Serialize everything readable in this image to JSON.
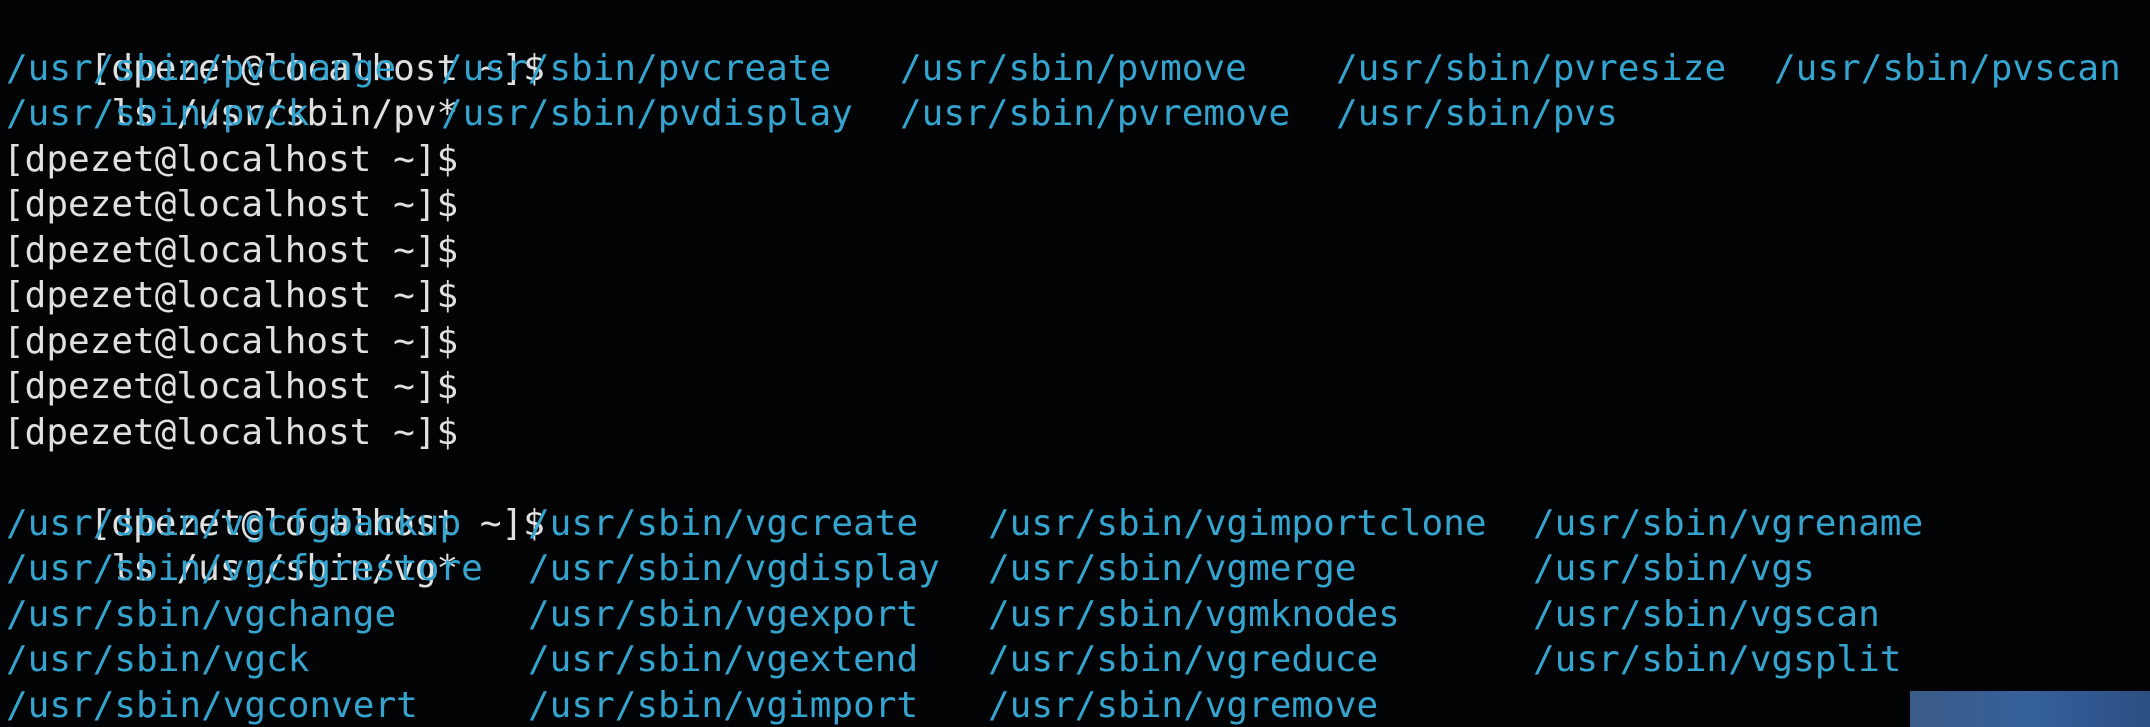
{
  "colors": {
    "background": "#020304",
    "prompt_text": "#e0e0e0",
    "executable_text": "#35a4ce"
  },
  "prompt": "[dpezet@localhost ~]$",
  "commands": {
    "pv": "ls /usr/sbin/pv*",
    "vg": "ls /usr/sbin/vg*"
  },
  "pv_listing": [
    [
      "/usr/sbin/pvchange",
      "/usr/sbin/pvcreate",
      "/usr/sbin/pvmove",
      "/usr/sbin/pvresize",
      "/usr/sbin/pvscan"
    ],
    [
      "/usr/sbin/pvck",
      "/usr/sbin/pvdisplay",
      "/usr/sbin/pvremove",
      "/usr/sbin/pvs"
    ]
  ],
  "vg_listing": [
    [
      "/usr/sbin/vgcfgbackup",
      "/usr/sbin/vgcreate",
      "/usr/sbin/vgimportclone",
      "/usr/sbin/vgrename"
    ],
    [
      "/usr/sbin/vgcfgrestore",
      "/usr/sbin/vgdisplay",
      "/usr/sbin/vgmerge",
      "/usr/sbin/vgs"
    ],
    [
      "/usr/sbin/vgchange",
      "/usr/sbin/vgexport",
      "/usr/sbin/vgmknodes",
      "/usr/sbin/vgscan"
    ],
    [
      "/usr/sbin/vgck",
      "/usr/sbin/vgextend",
      "/usr/sbin/vgreduce",
      "/usr/sbin/vgsplit"
    ],
    [
      "/usr/sbin/vgconvert",
      "/usr/sbin/vgimport",
      "/usr/sbin/vgremove"
    ]
  ]
}
